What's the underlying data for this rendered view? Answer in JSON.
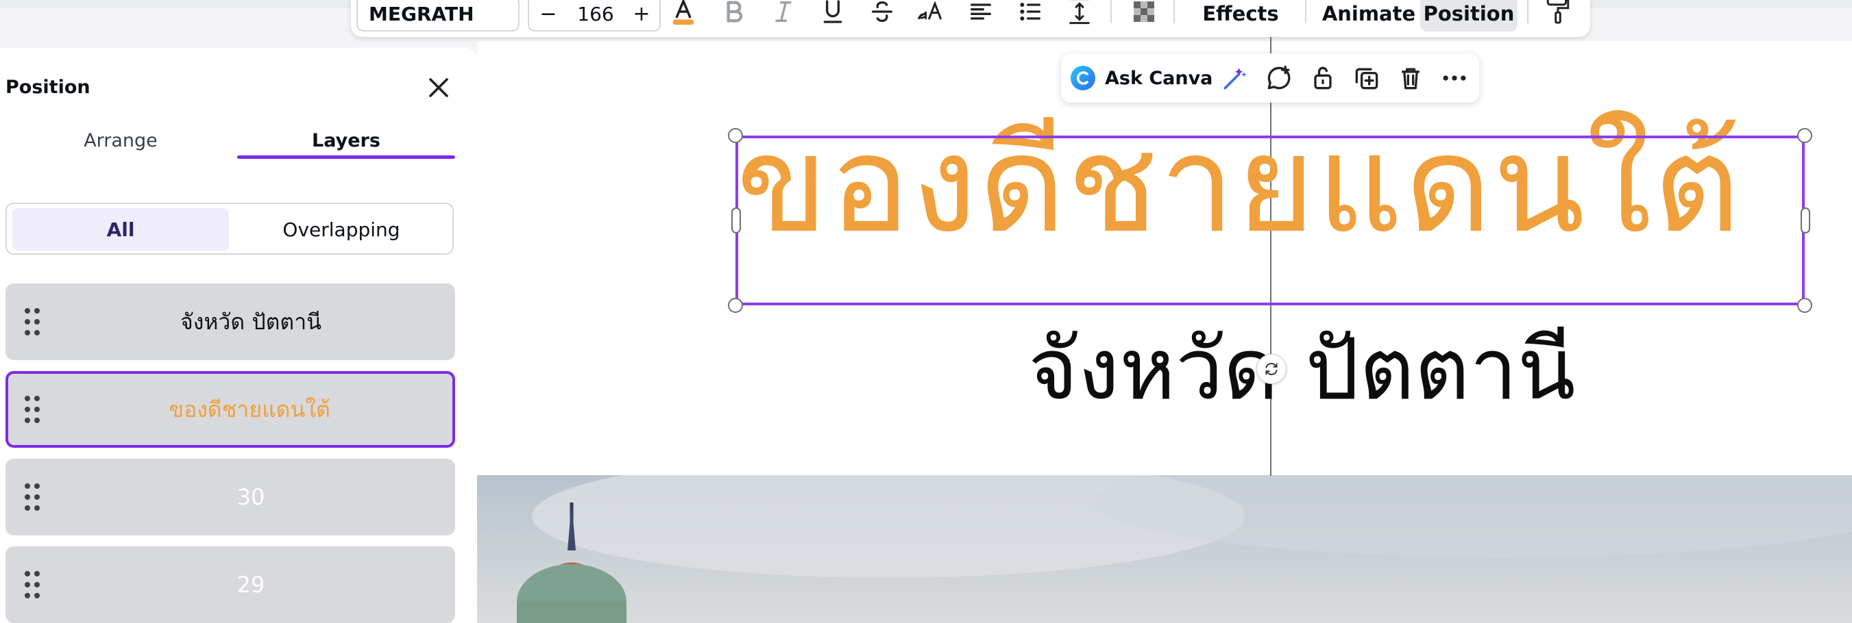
{
  "toolbar": {
    "font_name": "MEGRATH",
    "font_size": "166",
    "size_minus": "−",
    "size_plus": "+",
    "effects_label": "Effects",
    "animate_label": "Animate",
    "position_label": "Position",
    "text_color": "#f0a03c"
  },
  "context_toolbar": {
    "ask_label": "Ask Canva"
  },
  "panel": {
    "title": "Position",
    "tabs": [
      "Arrange",
      "Layers"
    ],
    "active_tab": "Layers",
    "filters": [
      "All",
      "Overlapping"
    ],
    "active_filter": "All",
    "layers": [
      {
        "label": "จังหวัด ปัตตานี",
        "color": "#0d1216",
        "selected": false
      },
      {
        "label": "ของดีชายแดนใต้",
        "color": "#f0a03c",
        "selected": true
      },
      {
        "label": "30",
        "color": "#ffffff",
        "selected": false
      },
      {
        "label": "29",
        "color": "#ffffff",
        "selected": false
      }
    ]
  },
  "canvas": {
    "title_text": "ของดีชายแดนใต้",
    "subtitle_text": "จังหวัด ปัตตานี",
    "accent_color": "#7d2ae8"
  }
}
